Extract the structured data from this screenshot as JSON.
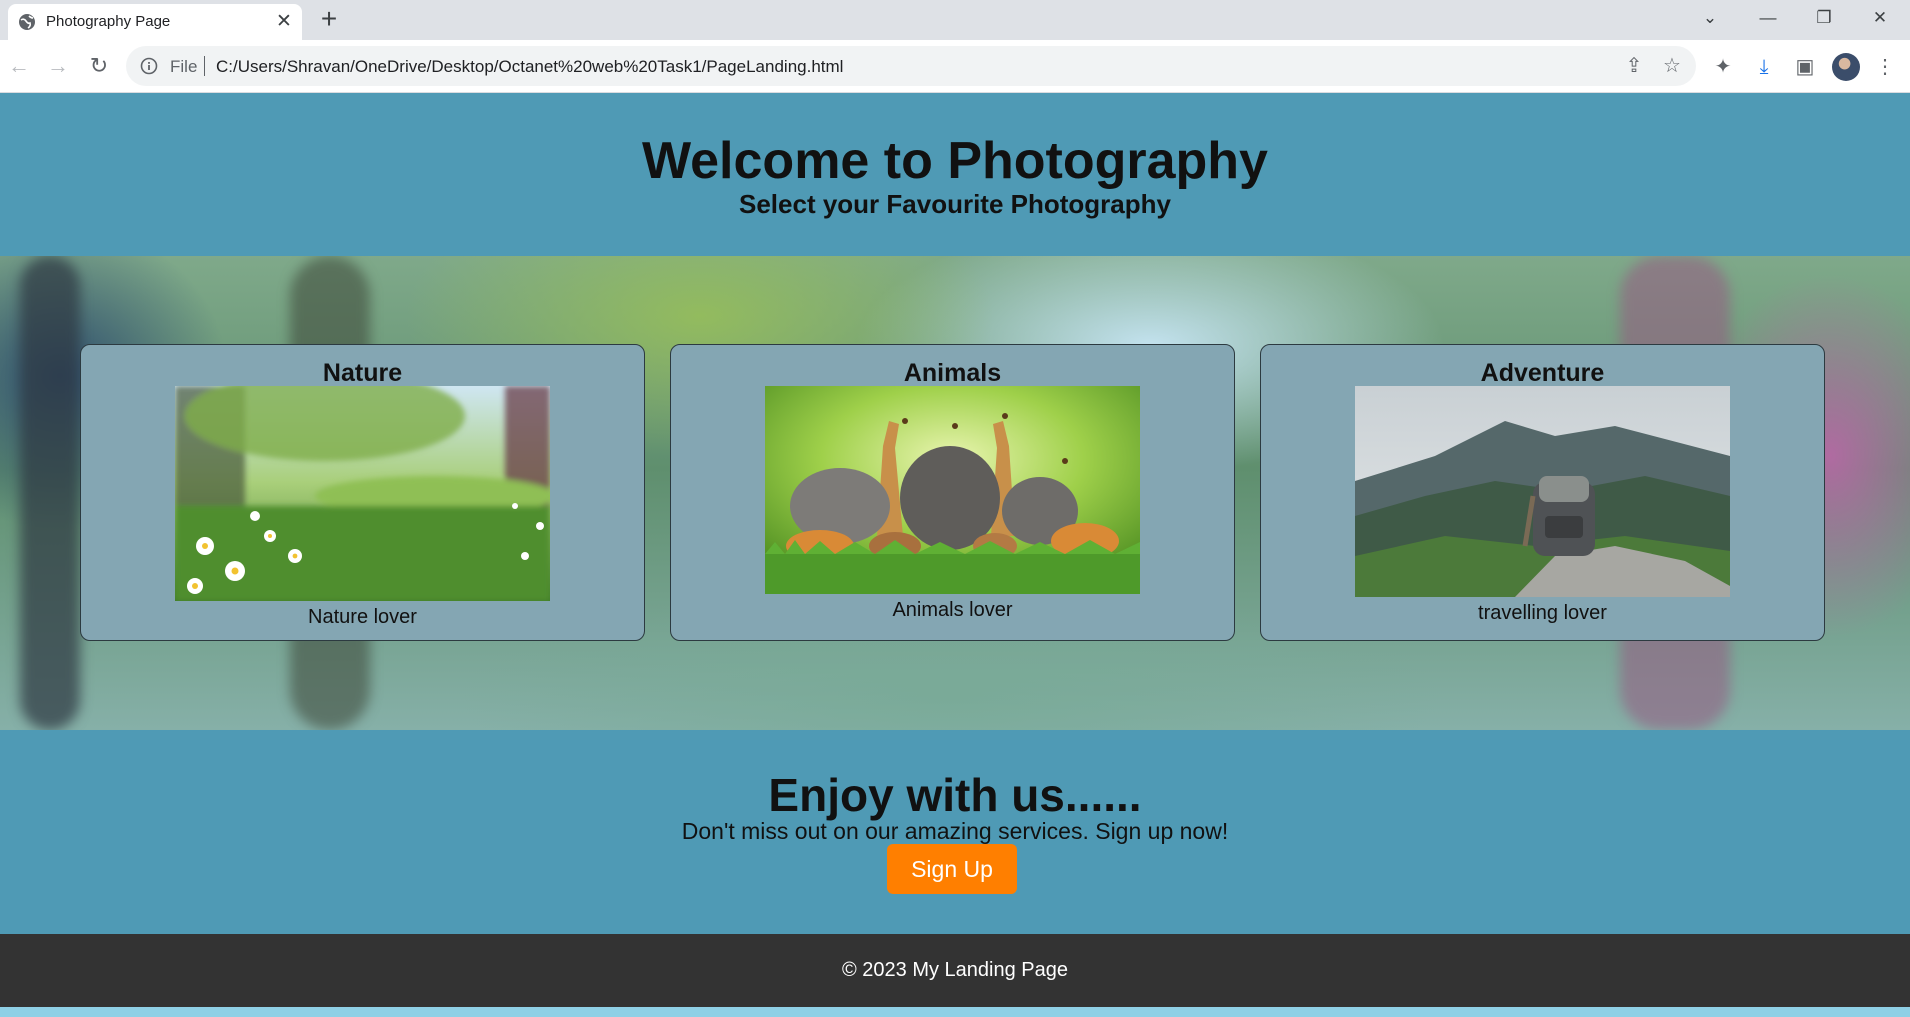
{
  "browser": {
    "tab_title": "Photography Page",
    "tab_close_symbol": "✕",
    "new_tab_symbol": "+",
    "file_label": "File",
    "url": "C:/Users/Shravan/OneDrive/Desktop/Octanet%20web%20Task1/PageLanding.html",
    "icons": [
      "globe-icon",
      "back-icon",
      "forward-icon",
      "reload-icon",
      "info-icon",
      "share-icon",
      "star-icon",
      "extensions-icon",
      "download-icon",
      "sidebar-icon",
      "menu-icon"
    ]
  },
  "header": {
    "title": "Welcome to Photography",
    "subtitle": "Select your Favourite Photography"
  },
  "cards": [
    {
      "title": "Nature",
      "caption": "Nature lover"
    },
    {
      "title": "Animals",
      "caption": "Animals lover"
    },
    {
      "title": "Adventure",
      "caption": "travelling lover"
    }
  ],
  "cta": {
    "heading": "Enjoy with us......",
    "text": "Don't miss out on our amazing services. Sign up now!",
    "button_label": "Sign Up"
  },
  "footer": {
    "text": "© 2023 My Landing Page"
  },
  "colors": {
    "page_bg": "#4f9ab5",
    "card_bg": "#84a6b3",
    "button": "#ff7f00",
    "footer_bg": "#333333"
  }
}
